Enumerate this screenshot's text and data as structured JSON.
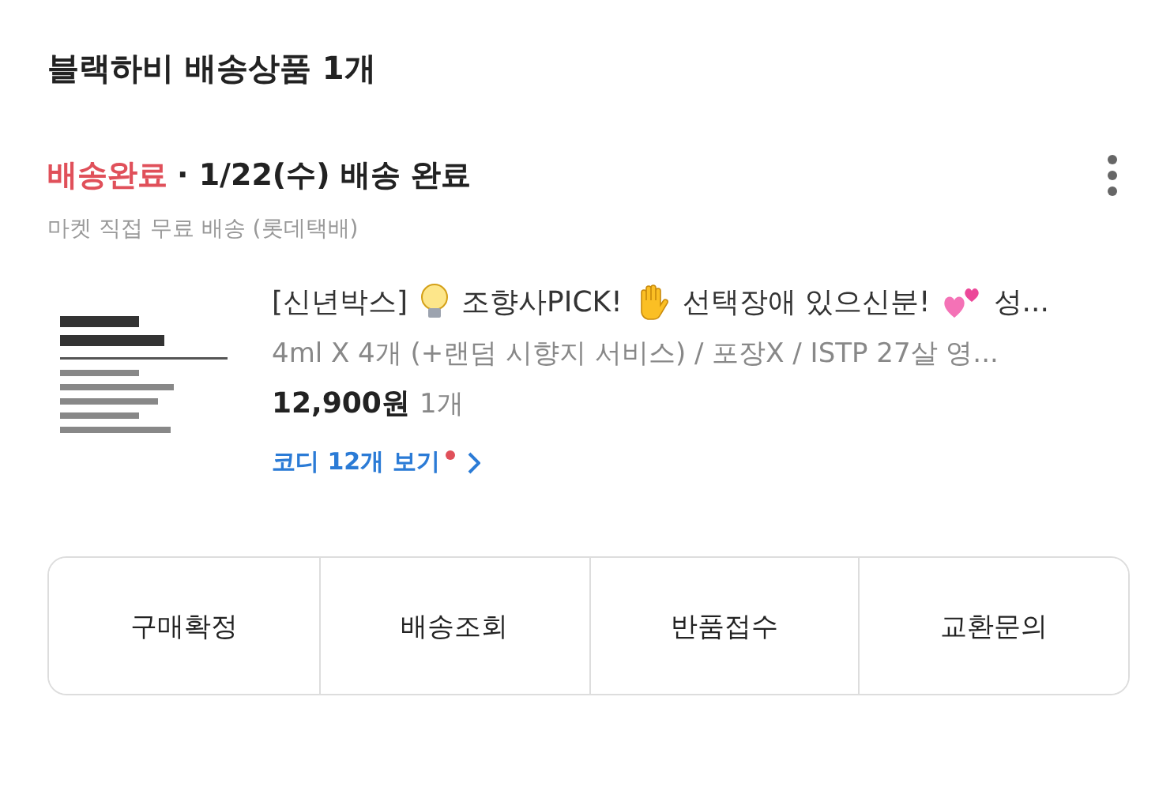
{
  "header": {
    "title": "블랙하비 배송상품 1개"
  },
  "shipment": {
    "status": "배송완료",
    "detail": "· 1/22(수) 배송 완료",
    "carrier": "마켓 직접 무료 배송 (롯데택배)"
  },
  "product": {
    "title_parts": [
      {
        "kind": "text",
        "text": "[신년박스]"
      },
      {
        "kind": "bulb"
      },
      {
        "kind": "text",
        "text": "조향사PICK!"
      },
      {
        "kind": "hand"
      },
      {
        "kind": "text",
        "text": "선택장애 있으신분!"
      },
      {
        "kind": "hearts"
      },
      {
        "kind": "text",
        "text": "성..."
      }
    ],
    "option": "4ml X 4개 (+랜덤 시향지 서비스) / 포장X / ISTP 27살 영...",
    "price": "12,900원",
    "quantity": "1개",
    "link": {
      "text": "코디 12개 보기",
      "new": true
    }
  },
  "actions": [
    "구매확정",
    "배송조회",
    "반품접수",
    "교환문의"
  ]
}
